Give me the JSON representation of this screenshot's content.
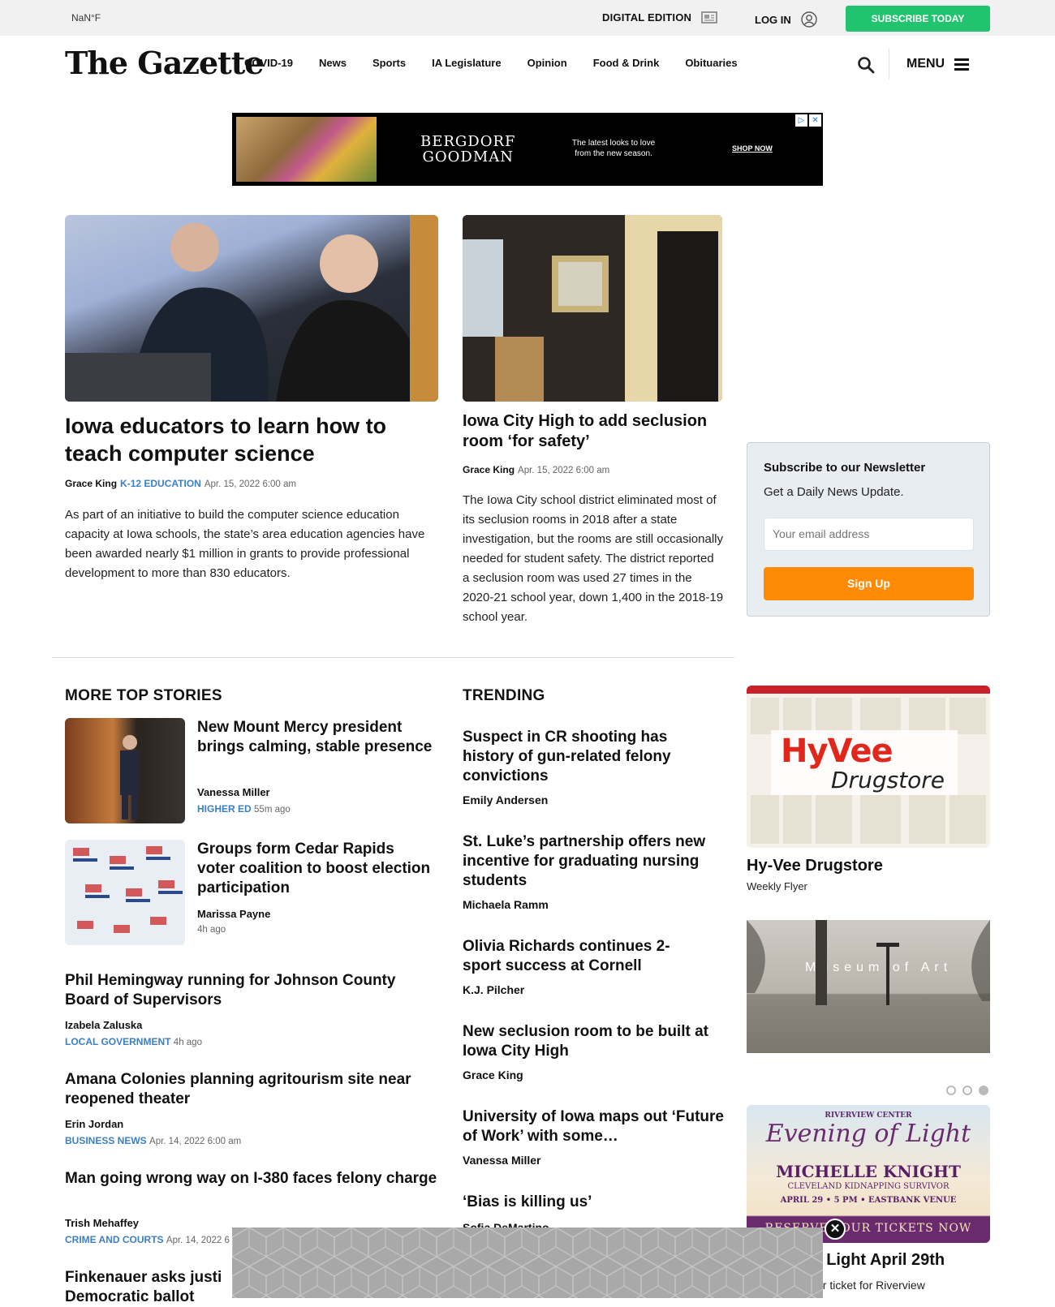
{
  "topbar": {
    "temperature": "NaN°F",
    "digital_edition": "DIGITAL EDITION",
    "login": "LOG IN",
    "subscribe": "SUBSCRIBE TODAY"
  },
  "header": {
    "logo": "The Gazette",
    "nav": [
      "COVID-19",
      "News",
      "Sports",
      "IA Legislature",
      "Opinion",
      "Food & Drink",
      "Obituaries"
    ],
    "menu": "MENU"
  },
  "top_ad": {
    "brand_line1": "BERGDORF",
    "brand_line2": "GOODMAN",
    "tagline": "The latest looks to love from the new season.",
    "cta": "SHOP NOW"
  },
  "lead_story": {
    "title": "Iowa educators to learn how to teach computer science",
    "author": "Grace King",
    "category": "K-12 EDUCATION",
    "date": "Apr. 15, 2022 6:00 am",
    "summary": "As part of an initiative to build the computer science education capacity at Iowa schools, the state’s area education agencies have been awarded nearly $1 million in grants to provide professional development to more than 830 educators."
  },
  "second_story": {
    "title": "Iowa City High to add seclusion room ‘for safety’",
    "author": "Grace King",
    "date": "Apr. 15, 2022 6:00 am",
    "summary": "The Iowa City school district eliminated most of its seclusion rooms in 2018 after a state investigation, but the rooms are still occasionally needed for student safety. The district reported a seclusion room was used 27 times in the 2020-21 school year, down 1,400 in the 2018-19 school year."
  },
  "newsletter": {
    "title": "Subscribe to our Newsletter",
    "subtitle": "Get a Daily News Update.",
    "email_placeholder": "Your email address",
    "button": "Sign Up"
  },
  "more_top_stories": {
    "heading": "MORE TOP STORIES",
    "items": [
      {
        "title": "New Mount Mercy president brings calming, stable presence",
        "author": "Vanessa Miller",
        "category": "HIGHER ED",
        "time": "55m ago"
      },
      {
        "title": "Groups form Cedar Rapids voter coalition to boost election participation",
        "author": "Marissa Payne",
        "category": "",
        "time": "4h ago"
      },
      {
        "title": "Phil Hemingway running for Johnson County Board of Supervisors",
        "author": "Izabela Zaluska",
        "category": "LOCAL GOVERNMENT",
        "time": "4h ago"
      },
      {
        "title": "Amana Colonies planning agritourism site near reopened theater",
        "author": "Erin Jordan",
        "category": "BUSINESS NEWS",
        "time": "Apr. 14, 2022 6:00 am"
      },
      {
        "title": "Man going wrong way on I-380 faces felony charge",
        "author": "Trish Mehaffey",
        "category": "CRIME AND COURTS",
        "time": "Apr. 14, 2022 6"
      },
      {
        "title": "Finkenauer asks justi",
        "title2": "Democratic ballot"
      }
    ]
  },
  "trending": {
    "heading": "TRENDING",
    "items": [
      {
        "title": "Suspect in CR shooting has history of gun-related felony convictions",
        "author": "Emily Andersen"
      },
      {
        "title": "St. Luke’s partnership offers new incentive for graduating nursing students",
        "author": "Michaela Ramm"
      },
      {
        "title": "Olivia Richards continues 2-sport success at Cornell",
        "author": "K.J. Pilcher"
      },
      {
        "title": "New seclusion room to be built at Iowa City High",
        "author": "Grace King"
      },
      {
        "title": "University of Iowa maps out ‘Future of Work’ with some…",
        "author": "Vanessa Miller"
      },
      {
        "title": "‘Bias is killing us’",
        "author": "Sofia DeMartino"
      }
    ]
  },
  "sidebar": {
    "hyvee_logo": "HyVee",
    "hyvee_logo2": "Drugstore",
    "hyvee_title": "Hy-Vee Drugstore",
    "hyvee_sub": "Weekly Flyer",
    "museum_text": "Museum of Art",
    "evening_top": "RIVERVIEW CENTER",
    "evening_title": "Evening of Light",
    "evening_name": "MICHELLE KNIGHT",
    "evening_sub": "CLEVELAND KIDNAPPING SURVIVOR",
    "evening_date": "APRIL 29 • 5 PM • EASTBANK VENUE",
    "evening_cta": "RESERVE YOUR TICKETS NOW",
    "evening_headline": "f Light April 29th",
    "evening_blurb": "ur ticket for  Riverview"
  },
  "colors": {
    "subscribe_green": "#22c36e",
    "signup_orange": "#ff8a05",
    "category_blue": "#3b7fc4"
  }
}
